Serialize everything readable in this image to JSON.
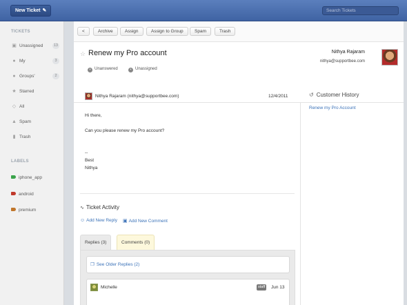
{
  "topbar": {
    "new_ticket_label": "New Ticket",
    "search_placeholder": "Search Tickets"
  },
  "sidebar": {
    "tickets_title": "TICKETS",
    "items": [
      {
        "label": "Unassigned",
        "count": "13",
        "icon": "inbox-icon"
      },
      {
        "label": "My",
        "count": "3",
        "icon": "user-icon"
      },
      {
        "label": "Groups'",
        "count": "2",
        "icon": "group-icon"
      },
      {
        "label": "Starred",
        "count": "",
        "icon": "star-icon"
      },
      {
        "label": "All",
        "count": "",
        "icon": "tag-icon"
      },
      {
        "label": "Spam",
        "count": "",
        "icon": "spam-icon"
      },
      {
        "label": "Trash",
        "count": "",
        "icon": "trash-icon"
      }
    ],
    "labels_title": "LABELS",
    "labels": [
      {
        "label": "iphone_app",
        "color": "#3aa34a"
      },
      {
        "label": "android",
        "color": "#c0392b"
      },
      {
        "label": "premium",
        "color": "#c0762b"
      }
    ]
  },
  "toolbar": {
    "back_label": "<",
    "archive": "Archive",
    "assign": "Assign",
    "assign_group": "Assign to Group",
    "spam": "Spam",
    "trash": "Trash"
  },
  "ticket": {
    "subject": "Renew my Pro account",
    "status_unanswered": "Unanswered",
    "status_unassigned": "Unassigned",
    "requester_name": "Nithya Rajaram",
    "requester_email": "nithya@supportbee.com"
  },
  "message": {
    "from": "Nithya Rajaram (nithya@supportbee.com)",
    "date": "12/4/2011",
    "lines": [
      "Hi there,",
      "Can you please renew my Pro account?",
      "--",
      "Best",
      "Nithya"
    ]
  },
  "activity": {
    "title": "Ticket Activity",
    "add_reply": "Add New Reply",
    "add_comment": "Add New Comment",
    "tab_replies": "Replies (3)",
    "tab_comments": "Comments (0)",
    "older_replies": "See Older Replies (2)",
    "reply_name": "Michelle",
    "reply_badge": "staff",
    "reply_date": "Jun 13"
  },
  "history": {
    "title": "Customer History",
    "link": "Renew my Pro Account"
  },
  "colors": {
    "accent": "#3b72b8",
    "topbar": "#4a6fb0"
  }
}
